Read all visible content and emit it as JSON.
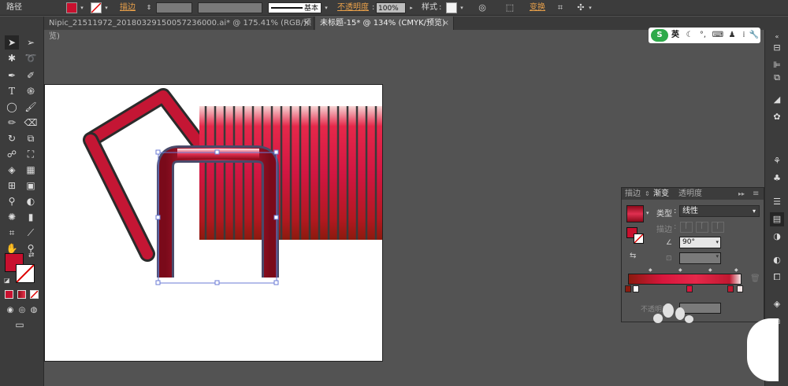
{
  "control_bar": {
    "object_type": "路径",
    "stroke_label": "描边",
    "stroke_profile": "基本",
    "opacity_label": "不透明度",
    "opacity_value": "100%",
    "style_label": "样式",
    "transform_label": "变换",
    "fill_color": "#c8102e"
  },
  "tabs": [
    {
      "label": "Nipic_21511972_20180329150057236000.ai* @ 175.41% (RGB/预览)"
    },
    {
      "label": "未标题-15* @ 134% (CMYK/预览)"
    }
  ],
  "ime": {
    "brand": "S",
    "mode": "英"
  },
  "gradient_panel": {
    "tabs": [
      "描边",
      "渐变",
      "透明度"
    ],
    "type_label": "类型",
    "type_value": "线性",
    "stroke_label": "描边",
    "angle_value": "90°",
    "opacity_label": "不透明度"
  },
  "colors": {
    "accent_red": "#c8102e",
    "dark_red": "#8b0a1a",
    "panel_bg": "#535353"
  }
}
